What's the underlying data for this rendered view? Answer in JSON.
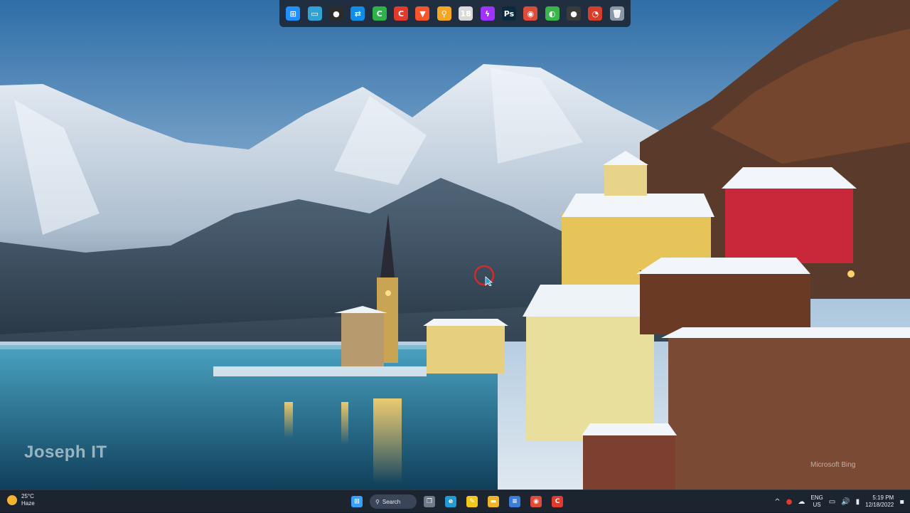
{
  "wallpaper": {
    "watermark": "Joseph IT",
    "bing_credit": "Microsoft Bing"
  },
  "dock": {
    "items": [
      {
        "icon": "windows-start-icon",
        "glyph": "⊞",
        "color": "#1e90ff"
      },
      {
        "icon": "desktop-icon",
        "glyph": "▭",
        "color": "#2ea3d6"
      },
      {
        "icon": "obs-icon",
        "glyph": "●",
        "color": "#2b2b2b"
      },
      {
        "icon": "teamviewer-icon",
        "glyph": "⇄",
        "color": "#0e8ee9"
      },
      {
        "icon": "camtasia-green-icon",
        "glyph": "C",
        "color": "#2eb24a"
      },
      {
        "icon": "camtasia-red-icon",
        "glyph": "C",
        "color": "#e23b2e"
      },
      {
        "icon": "brave-icon",
        "glyph": "▼",
        "color": "#fb542b"
      },
      {
        "icon": "search-tool-icon",
        "glyph": "⚲",
        "color": "#f5a623"
      },
      {
        "icon": "calendar-icon",
        "glyph": "18",
        "color": "#d9d9d9"
      },
      {
        "icon": "messenger-icon",
        "glyph": "ϟ",
        "color": "#a033ff"
      },
      {
        "icon": "photoshop-icon",
        "glyph": "Ps",
        "color": "#0a2a3d"
      },
      {
        "icon": "chrome-icon",
        "glyph": "◉",
        "color": "#dd4b39"
      },
      {
        "icon": "network-globe-icon",
        "glyph": "◐",
        "color": "#39b54a"
      },
      {
        "icon": "obs-dark-icon",
        "glyph": "●",
        "color": "#3a3a3a"
      },
      {
        "icon": "ccleaner-icon",
        "glyph": "◔",
        "color": "#d63d2b"
      },
      {
        "icon": "recycle-bin-icon",
        "glyph": "🗑",
        "color": "#8a97a8"
      }
    ]
  },
  "taskbar": {
    "weather": {
      "temperature": "25°C",
      "condition": "Haze"
    },
    "search_label": "Search",
    "apps": [
      {
        "icon": "windows-start-icon",
        "glyph": "⊞",
        "color": "#3aa0ff"
      },
      {
        "icon": "task-view-icon",
        "glyph": "❐",
        "color": "#6e7b8c"
      },
      {
        "icon": "edge-icon",
        "glyph": "e",
        "color": "#1f9cd6"
      },
      {
        "icon": "sticky-notes-icon",
        "glyph": "✎",
        "color": "#f2c81e"
      },
      {
        "icon": "file-explorer-icon",
        "glyph": "▬",
        "color": "#f0b429"
      },
      {
        "icon": "notepad-icon",
        "glyph": "≡",
        "color": "#3b7ddb"
      },
      {
        "icon": "chrome-icon",
        "glyph": "◉",
        "color": "#dd4b39"
      },
      {
        "icon": "camtasia-icon",
        "glyph": "C",
        "color": "#e23b2e"
      }
    ],
    "tray": {
      "language_top": "ENG",
      "language_bottom": "US",
      "time": "5:19 PM",
      "date": "12/18/2022"
    }
  }
}
